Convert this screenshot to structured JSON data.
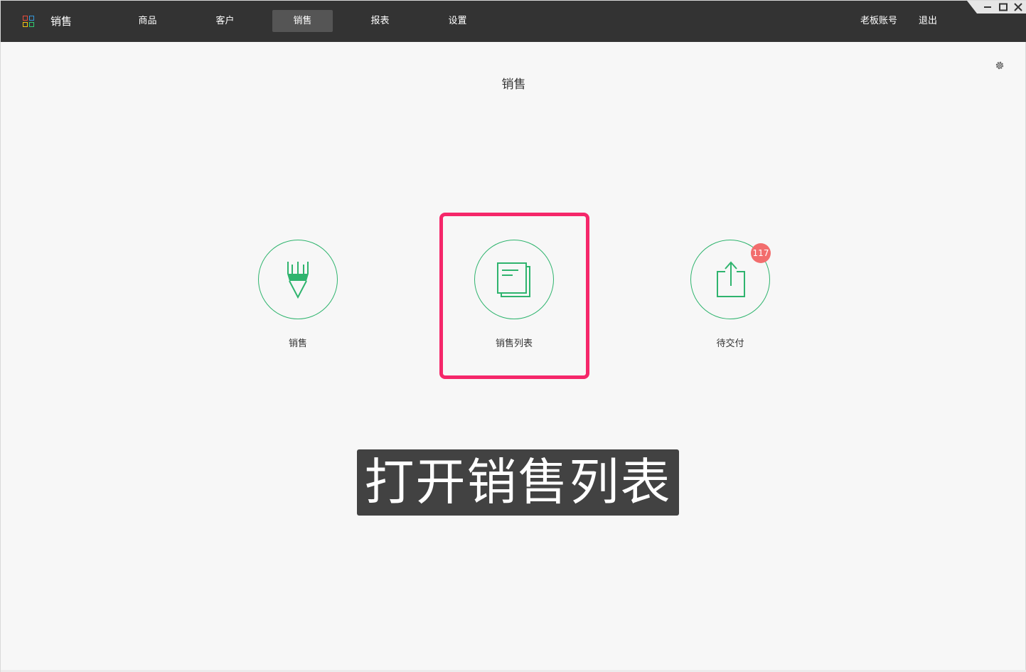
{
  "app": {
    "title": "销售"
  },
  "nav": [
    {
      "label": "商品"
    },
    {
      "label": "客户"
    },
    {
      "label": "销售",
      "active": true
    },
    {
      "label": "报表"
    },
    {
      "label": "设置"
    }
  ],
  "account": {
    "boss_account": "老板账号",
    "logout": "退出"
  },
  "page": {
    "title": "销售"
  },
  "tiles": [
    {
      "label": "销售",
      "icon": "pencil-icon"
    },
    {
      "label": "销售列表",
      "icon": "document-list-icon"
    },
    {
      "label": "待交付",
      "icon": "share-upload-icon",
      "badge": "117"
    }
  ],
  "caption": "打开销售列表",
  "colors": {
    "topbar": "#333333",
    "accent_green": "#2fb46e",
    "badge_red": "#f26d6d",
    "highlight_pink": "#f5276a",
    "caption_bg": "#424242"
  }
}
